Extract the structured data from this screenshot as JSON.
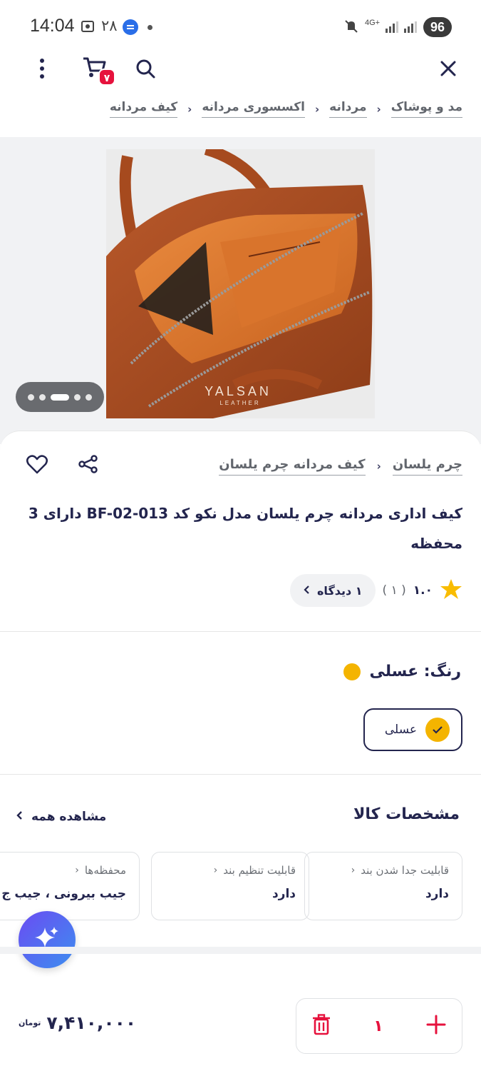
{
  "status_bar": {
    "time": "14:04",
    "notif_count": "۲۸",
    "signal_label": "4G+",
    "battery": "96"
  },
  "top_bar": {
    "cart_count": "۷"
  },
  "breadcrumb": [
    "مد و پوشاک",
    "مردانه",
    "اکسسوری مردانه",
    "کیف مردانه"
  ],
  "gallery": {
    "watermark": "YALSAN",
    "watermark_sub": "LEATHER",
    "page_count": 5,
    "active_page": 3
  },
  "product": {
    "brand_crumbs": [
      "چرم یلسان",
      "کیف مردانه چرم یلسان"
    ],
    "title": "کیف اداری مردانه چرم یلسان مدل نکو کد BF-02-013 دارای 3 محفظه",
    "rating": "۱.۰",
    "rating_count": "( ۱ )",
    "reviews_label": "۱ دیدگاه"
  },
  "color": {
    "label": "رنگ: عسلی",
    "selected": "عسلی",
    "hex": "#f4b400"
  },
  "specs": {
    "title": "مشخصات کالا",
    "see_all": "مشاهده همه",
    "items": [
      {
        "name": "قابلیت جدا شدن بند",
        "value": "دارد"
      },
      {
        "name": "قابلیت تنظیم بند",
        "value": "دارد"
      },
      {
        "name": "محفظه‌ها",
        "value": "جیب بیرونی ، جیب ج"
      }
    ]
  },
  "buy": {
    "quantity": "۱",
    "price": "۷,۴۱۰,۰۰۰",
    "currency": "تومان"
  },
  "colors": {
    "accent_red": "#e6123d",
    "text_dark": "#23254e"
  }
}
